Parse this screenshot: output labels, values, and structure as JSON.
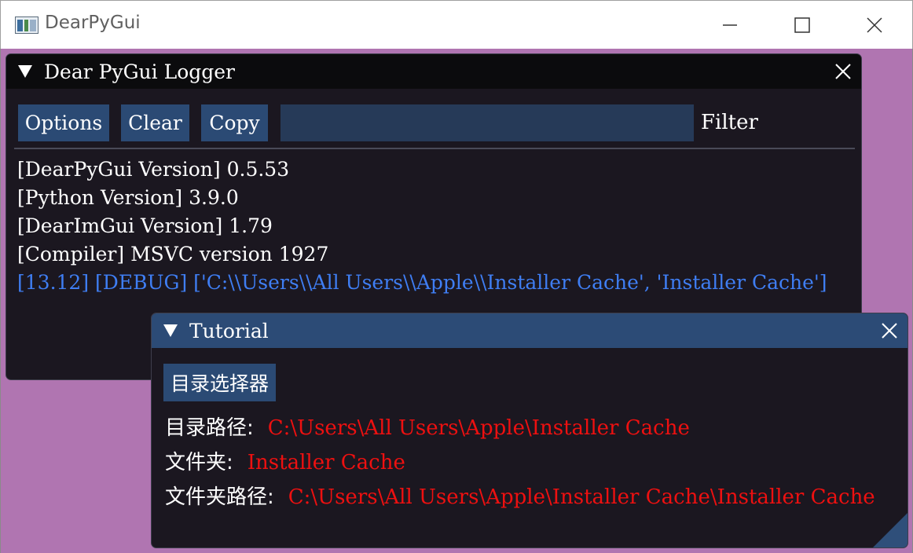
{
  "os_window": {
    "title": "DearPyGui"
  },
  "logger": {
    "title": "Dear PyGui Logger",
    "buttons": {
      "options": "Options",
      "clear": "Clear",
      "copy": "Copy"
    },
    "filter": {
      "value": "",
      "label": "Filter"
    },
    "lines": [
      "[DearPyGui Version] 0.5.53",
      "[Python Version] 3.9.0",
      "[DearImGui Version] 1.79",
      "[Compiler] MSVC version 1927",
      "[13.12] [DEBUG]  ['C:\\\\Users\\\\All Users\\\\Apple\\\\Installer Cache', 'Installer Cache']"
    ]
  },
  "tutorial": {
    "title": "Tutorial",
    "button_label": "目录选择器",
    "fields": [
      {
        "label": "目录路径:",
        "value": "C:\\Users\\All Users\\Apple\\Installer Cache"
      },
      {
        "label": "文件夹:",
        "value": "Installer Cache"
      },
      {
        "label": "文件夹路径:",
        "value": "C:\\Users\\All Users\\Apple\\Installer Cache\\Installer Cache"
      }
    ]
  },
  "colors": {
    "desktop_bg": "#b075b1",
    "window_bg": "#1b1720",
    "button": "#2b4a74",
    "debug_text": "#3f7ef3",
    "value_text": "#ee1010"
  },
  "icons": [
    "app-icon",
    "minimize-icon",
    "maximize-icon",
    "close-icon",
    "collapse-triangle-icon",
    "resize-grip-icon"
  ]
}
